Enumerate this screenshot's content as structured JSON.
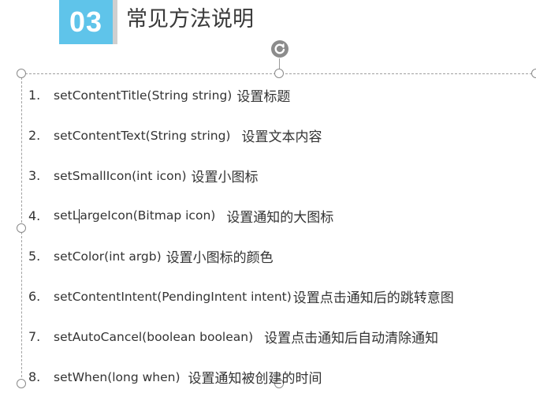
{
  "slide": {
    "number": "03",
    "title": "常见方法说明"
  },
  "methods": [
    {
      "index": "1.",
      "code": "setContentTitle(String string)",
      "desc": "设置标题"
    },
    {
      "index": "2.",
      "code": "setContentText(String string)",
      "desc": "设置文本内容"
    },
    {
      "index": "3.",
      "code": "setSmallIcon(int icon)",
      "desc": "设置小图标"
    },
    {
      "index": "4.",
      "code_before_caret": "setL",
      "code_after_caret": "argeIcon(Bitmap icon)",
      "desc": "设置通知的大图标"
    },
    {
      "index": "5.",
      "code": "setColor(int argb)",
      "desc": "设置小图标的颜色"
    },
    {
      "index": "6.",
      "code": "setContentIntent(PendingIntent intent)",
      "desc": "设置点击通知后的跳转意图"
    },
    {
      "index": "7.",
      "code": "setAutoCancel(boolean boolean)",
      "desc": "设置点击通知后自动清除通知"
    },
    {
      "index": "8.",
      "code": "setWhen(long when)",
      "desc": "设置通知被创建的时间"
    }
  ],
  "colors": {
    "badge": "#5fc4ea",
    "text": "#333333",
    "selection_border": "#a0a0a0"
  },
  "icons": {
    "rotate": "rotate-handle-icon"
  }
}
